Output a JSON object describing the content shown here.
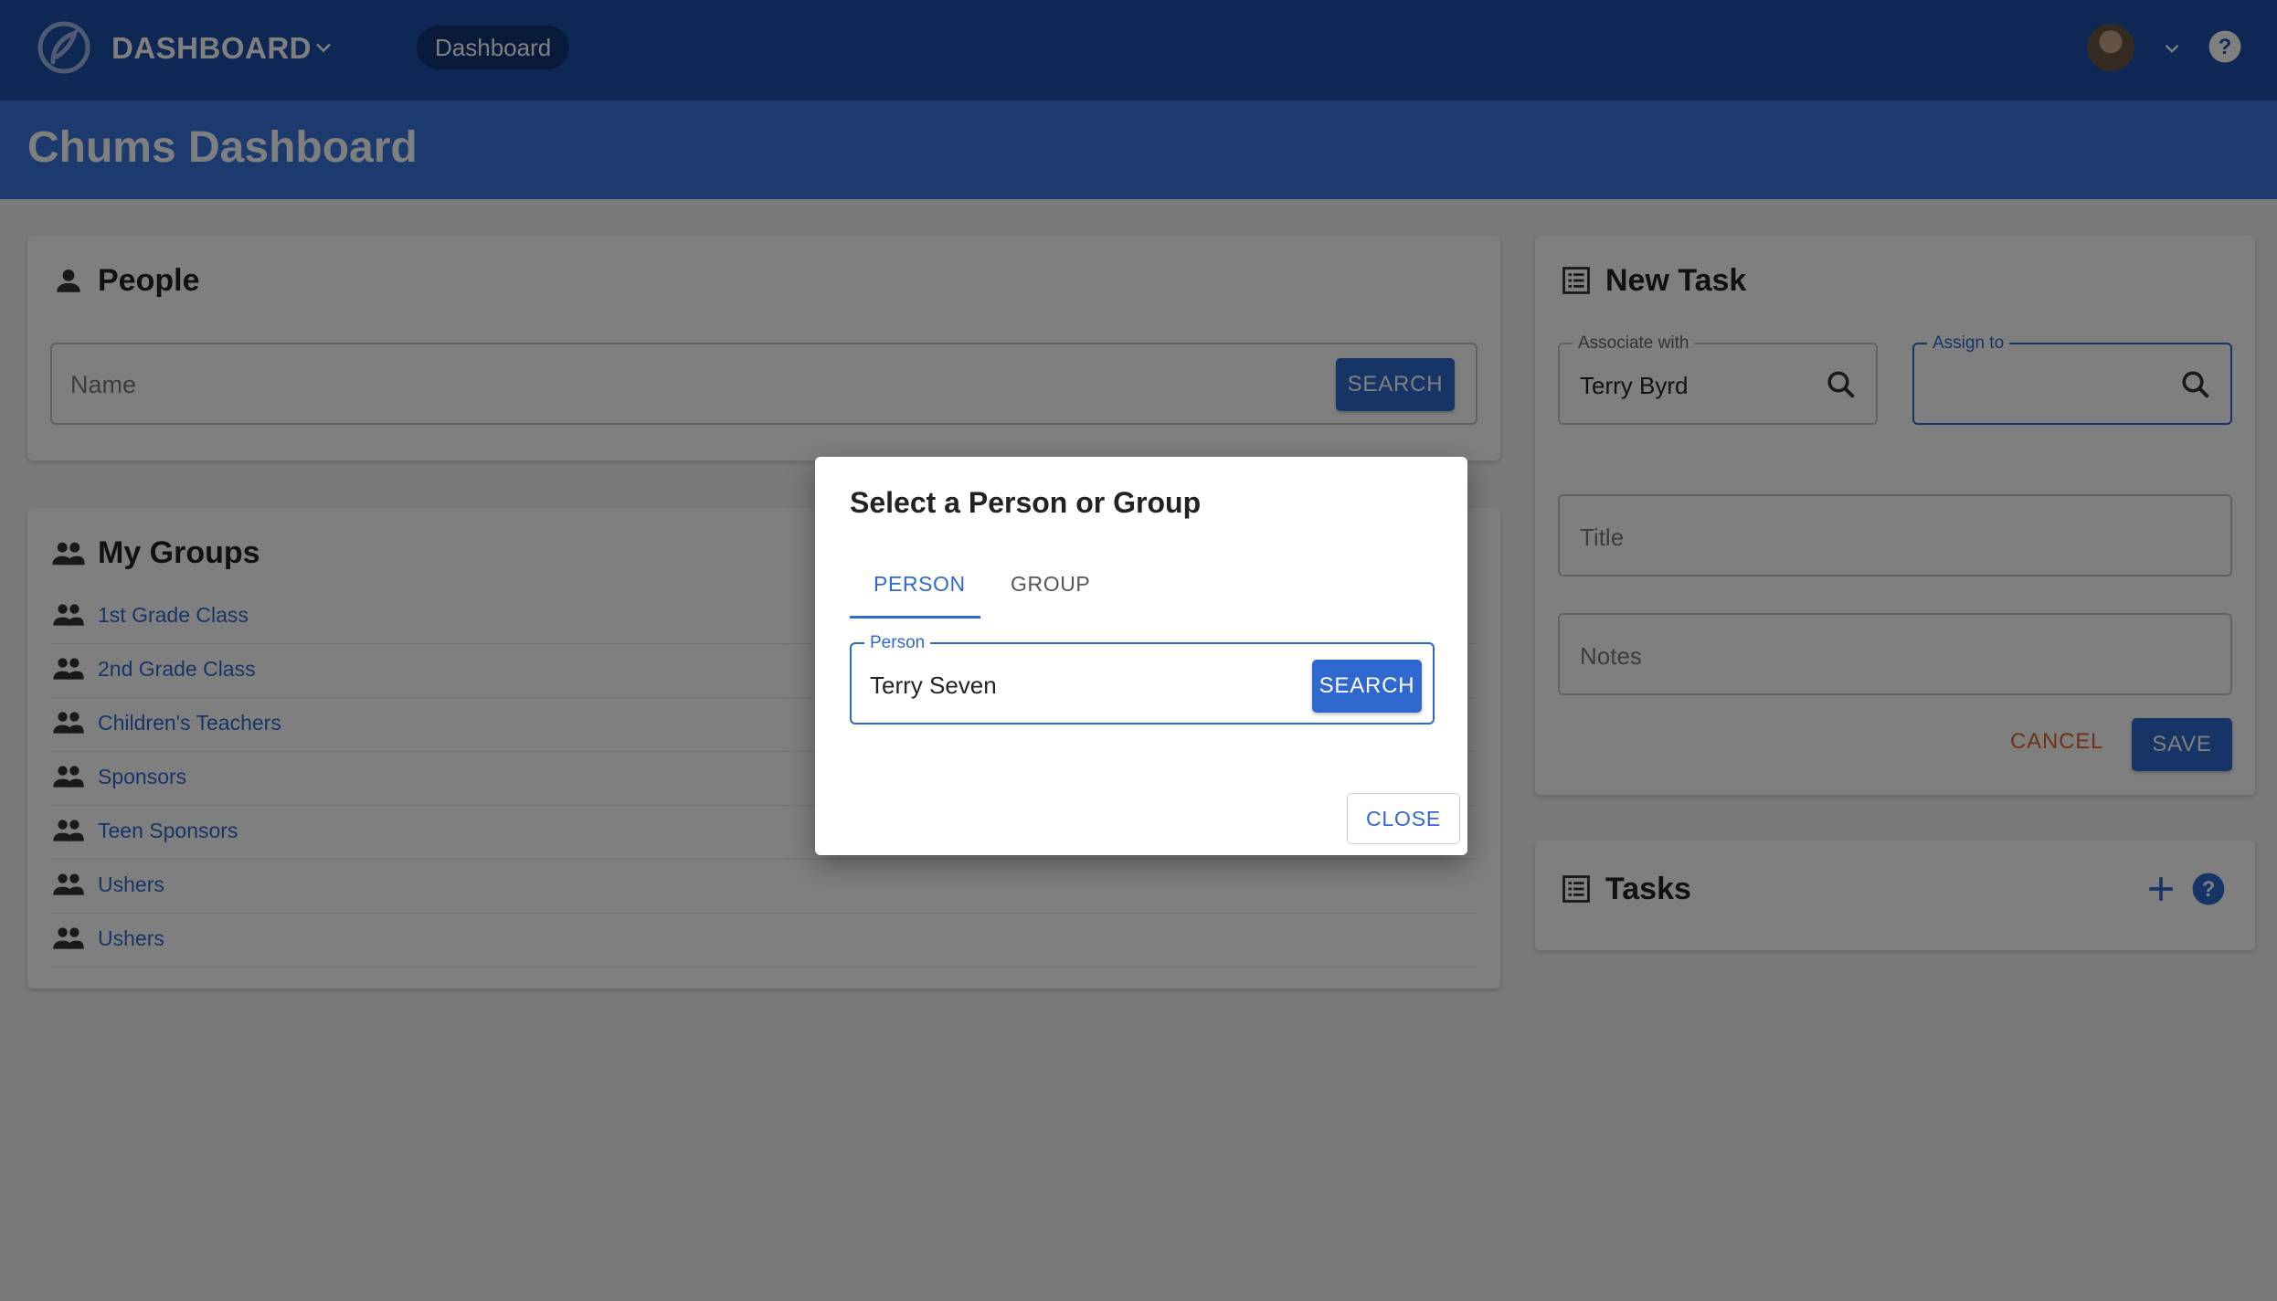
{
  "colors": {
    "appbar": "#1d4fa8",
    "page_header": "#3a74de",
    "primary": "#2f68cf",
    "cancel": "#e0642a"
  },
  "appbar": {
    "app_name": "DASHBOARD",
    "nav_item": "Dashboard",
    "logo_icon": "chums-logo-icon",
    "user_menu_icon": "chevron-down-icon",
    "help_icon": "help-icon"
  },
  "page": {
    "title": "Chums Dashboard"
  },
  "people": {
    "title": "People",
    "icon": "person-icon",
    "name_placeholder": "Name",
    "search_label": "SEARCH"
  },
  "groups": {
    "title": "My Groups",
    "icon": "group-icon",
    "items": [
      {
        "label": "1st Grade Class"
      },
      {
        "label": "2nd Grade Class"
      },
      {
        "label": "Children's Teachers"
      },
      {
        "label": "Sponsors"
      },
      {
        "label": "Teen Sponsors"
      },
      {
        "label": "Ushers"
      },
      {
        "label": "Ushers"
      }
    ]
  },
  "new_task": {
    "title": "New Task",
    "icon": "list-icon",
    "associate_label": "Associate with",
    "associate_value": "Terry Byrd",
    "assign_label": "Assign to",
    "assign_value": "",
    "title_placeholder": "Title",
    "notes_placeholder": "Notes",
    "cancel_label": "CANCEL",
    "save_label": "SAVE"
  },
  "tasks": {
    "title": "Tasks",
    "icon": "list-icon",
    "add_icon": "plus-icon",
    "help_icon": "help-icon"
  },
  "dialog": {
    "title": "Select a Person or Group",
    "tabs": [
      {
        "label": "PERSON",
        "active": true
      },
      {
        "label": "GROUP",
        "active": false
      }
    ],
    "person_label": "Person",
    "person_value": "Terry Seven",
    "search_label": "SEARCH",
    "close_label": "CLOSE"
  }
}
